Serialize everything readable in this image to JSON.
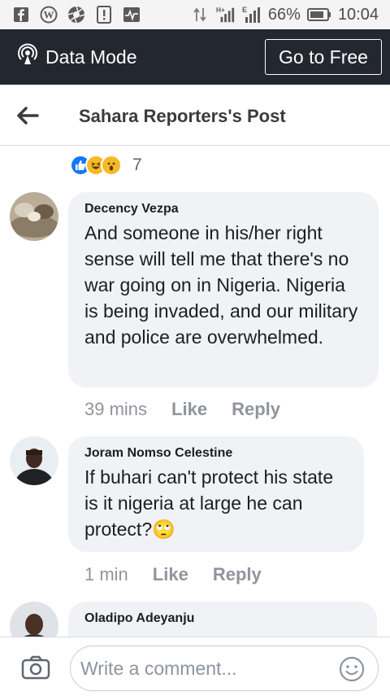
{
  "status_bar": {
    "battery": "66%",
    "time": "10:04",
    "icons": [
      "facebook-icon",
      "wordpress-icon",
      "aperture-icon",
      "alert-icon",
      "activity-icon",
      "data-arrows-icon",
      "signal-h-plus-icon",
      "signal-e-icon",
      "battery-icon"
    ]
  },
  "banner": {
    "mode_label": "Data Mode",
    "cta_label": "Go to Free"
  },
  "header": {
    "title": "Sahara Reporters's Post"
  },
  "reactions": {
    "types": [
      "like",
      "haha",
      "wow"
    ],
    "count": "7"
  },
  "comments": [
    {
      "author": "Decency Vezpa",
      "text": "And someone in his/her right sense will tell me that there's no war going on in Nigeria. Nigeria is being invaded, and our military and police are overwhelmed.",
      "time": "39 mins",
      "like_label": "Like",
      "reply_label": "Reply"
    },
    {
      "author": "Joram Nomso Celestine",
      "text": "If buhari can't protect his state is it nigeria at large he can protect?",
      "emoji": "🙄",
      "time": "1 min",
      "like_label": "Like",
      "reply_label": "Reply"
    },
    {
      "author": "Oladipo Adeyanju"
    }
  ],
  "composer": {
    "placeholder": "Write a comment..."
  },
  "colors": {
    "banner_bg": "#232730",
    "bubble_bg": "#f0f2f5",
    "like_blue": "#1877f2",
    "emoji_yellow": "#f7b928"
  }
}
